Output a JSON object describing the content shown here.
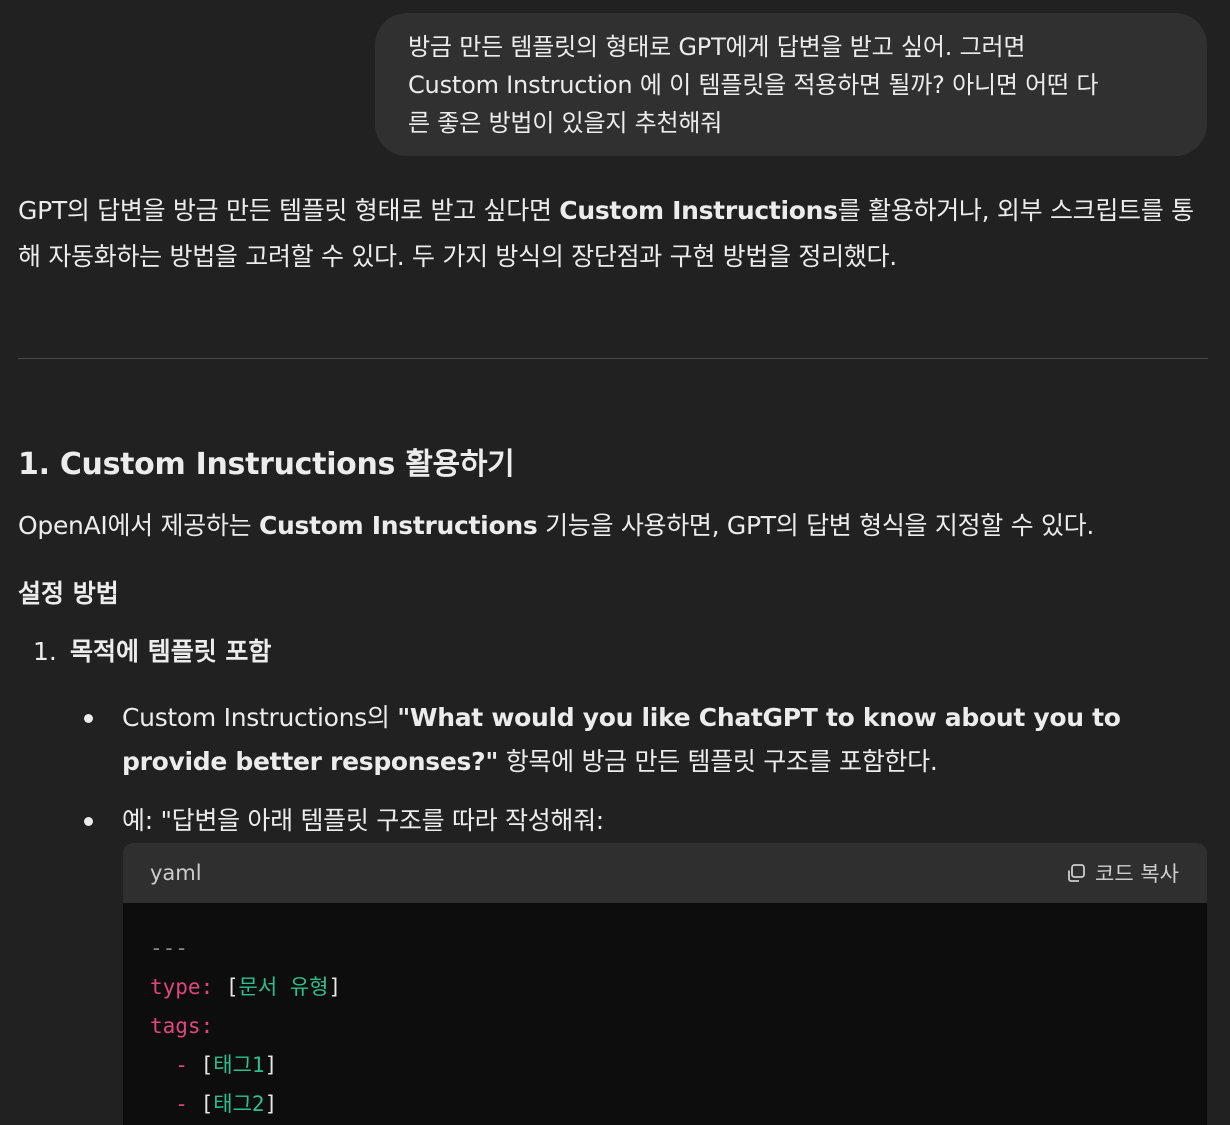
{
  "user_message": {
    "line1": "방금 만든 템플릿의 형태로 GPT에게 답변을 받고 싶어. 그러면",
    "line2": "Custom Instruction 에 이 템플릿을 적용하면 될까? 아니면 어떤 다",
    "line3": "른 좋은 방법이 있을지 추천해줘"
  },
  "assistant": {
    "intro_part1": "GPT의 답변을 방금 만든 템플릿 형태로 받고 싶다면 ",
    "intro_bold": "Custom Instructions",
    "intro_part2": "를 활용하거나, 외부 스크립트를 통해 자동화하는 방법을 고려할 수 있다. 두 가지 방식의 장단점과 구현 방법을 정리했다.",
    "section1_title": "1. Custom Instructions 활용하기",
    "section1_p_part1": "OpenAI에서 제공하는 ",
    "section1_p_bold": "Custom Instructions",
    "section1_p_part2": " 기능을 사용하면, GPT의 답변 형식을 지정할 수 있다.",
    "setup_heading": "설정 방법",
    "ol_number": "1.",
    "ol_item": "목적에 템플릿 포함",
    "bullet1_part1": "Custom Instructions의 ",
    "bullet1_bold": "\"What would you like ChatGPT to know about you to provide better responses?\"",
    "bullet1_part2": " 항목에 방금 만든 템플릿 구조를 포함한다.",
    "bullet2": "예: \"답변을 아래 템플릿 구조를 따라 작성해줘:"
  },
  "code_block": {
    "language": "yaml",
    "copy_label": "코드 복사",
    "line_dashes": "---",
    "type_key": "type:",
    "type_open": "[",
    "type_value": "문서 유형",
    "type_close": "]",
    "tags_key": "tags:",
    "tag_dash": "-",
    "tag_open": "[",
    "tag1": "태그1",
    "tag2": "태그2",
    "tag_close": "]"
  },
  "colors": {
    "background": "#212121",
    "user_bubble": "#303030",
    "code_header": "#2f2f2f",
    "code_body": "#0d0d0d",
    "yaml_key": "#e0467c",
    "yaml_string": "#2fbf8f"
  },
  "icons": {
    "copy": "copy-icon"
  }
}
